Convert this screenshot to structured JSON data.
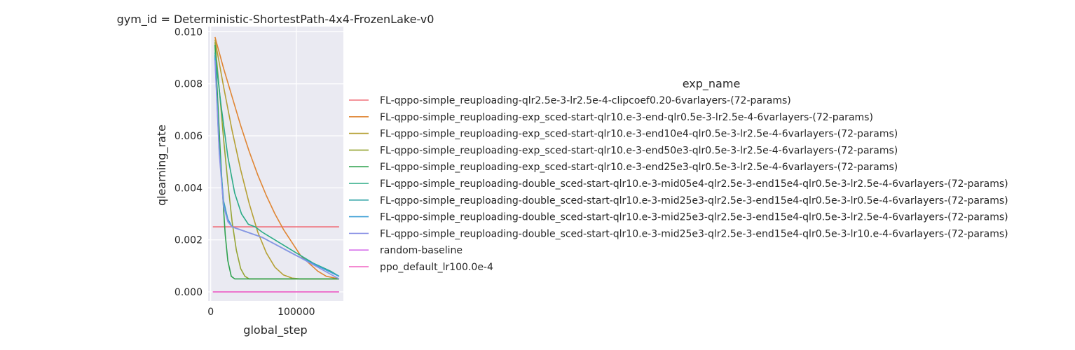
{
  "chart_data": {
    "type": "line",
    "title": "gym_id = Deterministic-ShortestPath-4x4-FrozenLake-v0",
    "xlabel": "global_step",
    "ylabel": "qlearning_rate",
    "xlim": [
      -3000,
      155000
    ],
    "ylim": [
      -0.00035,
      0.0102
    ],
    "xticks": [
      0,
      100000
    ],
    "xtick_labels": [
      "0",
      "100000"
    ],
    "yticks": [
      0.0,
      0.002,
      0.004,
      0.006,
      0.008,
      0.01
    ],
    "ytick_labels": [
      "0.000",
      "0.002",
      "0.004",
      "0.006",
      "0.008",
      "0.010"
    ],
    "grid": true,
    "legend_title": "exp_name",
    "legend_position": "right",
    "series": [
      {
        "name": "FL-qppo-simple_reuploading-qlr2.5e-3-lr2.5e-4-clipcoef0.20-6varlayers-(72-params)",
        "color": "#f0707a",
        "points": [
          [
            2500,
            0.0025
          ],
          [
            150000,
            0.0025
          ]
        ]
      },
      {
        "name": "FL-qppo-simple_reuploading-exp_sced-start-qlr10.e-3-end-qlr0.5e-3-lr2.5e-4-6varlayers-(72-params)",
        "color": "#e08533",
        "points": [
          [
            5000,
            0.0098
          ],
          [
            15000,
            0.0086
          ],
          [
            25000,
            0.0075
          ],
          [
            35000,
            0.0064
          ],
          [
            45000,
            0.0054
          ],
          [
            55000,
            0.0045
          ],
          [
            65000,
            0.0037
          ],
          [
            75000,
            0.003
          ],
          [
            85000,
            0.0024
          ],
          [
            95000,
            0.0019
          ],
          [
            105000,
            0.0014
          ],
          [
            115000,
            0.0011
          ],
          [
            125000,
            0.0008
          ],
          [
            135000,
            0.0006
          ],
          [
            150000,
            0.0005
          ]
        ]
      },
      {
        "name": "FL-qppo-simple_reuploading-exp_sced-start-qlr10.e-3-end10e4-qlr0.5e-3-lr2.5e-4-6varlayers-(72-params)",
        "color": "#b5a034",
        "points": [
          [
            5000,
            0.0097
          ],
          [
            15000,
            0.0079
          ],
          [
            25000,
            0.0062
          ],
          [
            35000,
            0.0047
          ],
          [
            45000,
            0.0034
          ],
          [
            55000,
            0.0023
          ],
          [
            65000,
            0.0015
          ],
          [
            75000,
            0.00095
          ],
          [
            85000,
            0.00065
          ],
          [
            95000,
            0.00053
          ],
          [
            105000,
            0.0005
          ],
          [
            150000,
            0.0005
          ]
        ]
      },
      {
        "name": "FL-qppo-simple_reuploading-exp_sced-start-qlr10.e-3-end50e3-qlr0.5e-3-lr2.5e-4-6varlayers-(72-params)",
        "color": "#96a534",
        "points": [
          [
            5000,
            0.0096
          ],
          [
            10000,
            0.0078
          ],
          [
            15000,
            0.0059
          ],
          [
            20000,
            0.0042
          ],
          [
            25000,
            0.0027
          ],
          [
            30000,
            0.0016
          ],
          [
            35000,
            0.0009
          ],
          [
            40000,
            0.0006
          ],
          [
            45000,
            0.0005
          ],
          [
            150000,
            0.0005
          ]
        ]
      },
      {
        "name": "FL-qppo-simple_reuploading-exp_sced-start-qlr10.e-3-end25e3-qlr0.5e-3-lr2.5e-4-6varlayers-(72-params)",
        "color": "#2fa24e",
        "points": [
          [
            5000,
            0.0095
          ],
          [
            8000,
            0.0075
          ],
          [
            11000,
            0.0055
          ],
          [
            14000,
            0.0037
          ],
          [
            17000,
            0.0022
          ],
          [
            20000,
            0.0012
          ],
          [
            24000,
            0.0006
          ],
          [
            28000,
            0.0005
          ],
          [
            150000,
            0.0005
          ]
        ]
      },
      {
        "name": "FL-qppo-simple_reuploading-double_sced-start-qlr10.e-3-mid05e4-qlr2.5e-3-end15e4-qlr0.5e-3-lr2.5e-4-6varlayers-(72-params)",
        "color": "#2bab86",
        "points": [
          [
            5000,
            0.0092
          ],
          [
            12000,
            0.0072
          ],
          [
            20000,
            0.0052
          ],
          [
            28000,
            0.0038
          ],
          [
            36000,
            0.003
          ],
          [
            44000,
            0.0026
          ],
          [
            52000,
            0.0025
          ],
          [
            60000,
            0.0023
          ],
          [
            80000,
            0.0019
          ],
          [
            100000,
            0.0015
          ],
          [
            120000,
            0.0011
          ],
          [
            140000,
            0.0008
          ],
          [
            150000,
            0.0006
          ]
        ]
      },
      {
        "name": "FL-qppo-simple_reuploading-double_sced-start-qlr10.e-3-mid25e3-qlr2.5e-3-end15e4-qlr0.5e-3-lr0.5e-4-6varlayers-(72-params)",
        "color": "#33a5a6",
        "points": [
          [
            5000,
            0.0091
          ],
          [
            10000,
            0.0055
          ],
          [
            15000,
            0.0035
          ],
          [
            20000,
            0.0028
          ],
          [
            25000,
            0.0025
          ],
          [
            60000,
            0.0021
          ],
          [
            100000,
            0.0014
          ],
          [
            150000,
            0.0006
          ]
        ]
      },
      {
        "name": "FL-qppo-simple_reuploading-double_sced-start-qlr10.e-3-mid25e3-qlr2.5e-3-end15e4-qlr0.5e-3-lr2.5e-4-6varlayers-(72-params)",
        "color": "#3b9fd6",
        "points": [
          [
            5000,
            0.009
          ],
          [
            10000,
            0.0054
          ],
          [
            15000,
            0.0034
          ],
          [
            20000,
            0.0028
          ],
          [
            25000,
            0.0025
          ],
          [
            60000,
            0.0021
          ],
          [
            100000,
            0.0014
          ],
          [
            150000,
            0.0006
          ]
        ]
      },
      {
        "name": "FL-qppo-simple_reuploading-double_sced-start-qlr10.e-3-mid25e3-qlr2.5e-3-end15e4-qlr0.5e-3-lr10.e-4-6varlayers-(72-params)",
        "color": "#8c93e6",
        "points": [
          [
            5000,
            0.0089
          ],
          [
            10000,
            0.0053
          ],
          [
            15000,
            0.0033
          ],
          [
            20000,
            0.0027
          ],
          [
            25000,
            0.0025
          ],
          [
            60000,
            0.0021
          ],
          [
            100000,
            0.0014
          ],
          [
            150000,
            0.0005
          ]
        ]
      },
      {
        "name": "random-baseline",
        "color": "#d56cea",
        "points": [
          [
            2500,
            0.0
          ],
          [
            150000,
            0.0
          ]
        ]
      },
      {
        "name": "ppo_default_lr100.0e-4",
        "color": "#f064c2",
        "points": [
          [
            2500,
            0.0
          ],
          [
            150000,
            0.0
          ]
        ]
      }
    ]
  }
}
